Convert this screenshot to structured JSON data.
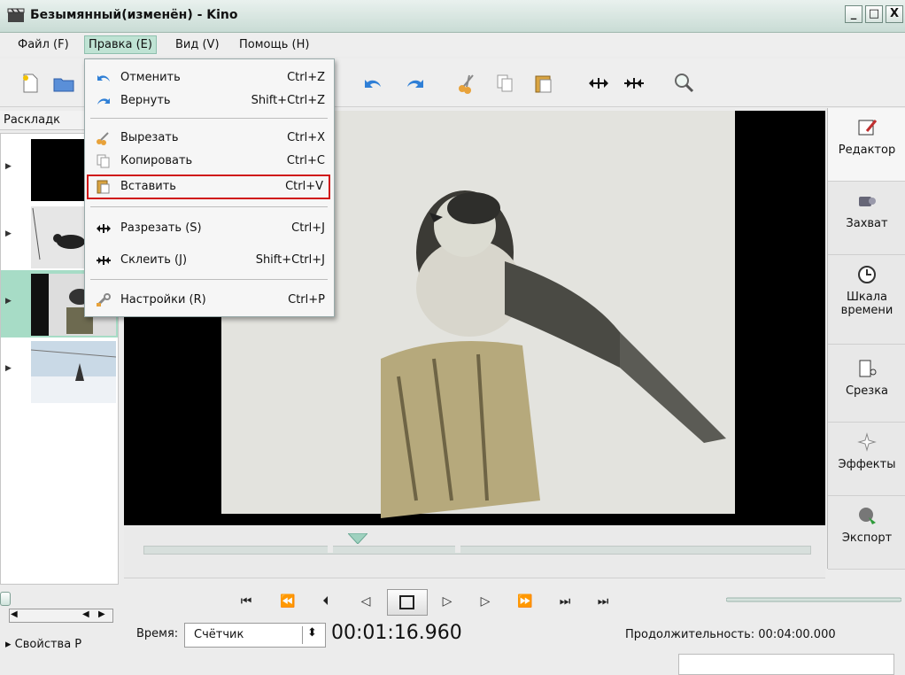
{
  "window": {
    "title": "Безымянный(изменён) - Kino",
    "minimize": "_",
    "maximize": "□",
    "close": "X"
  },
  "menubar": {
    "file": "Файл (F)",
    "edit": "Правка (E)",
    "view": "Вид (V)",
    "help": "Помощь (H)"
  },
  "edit_menu": {
    "items": [
      {
        "label": "Отменить",
        "shortcut": "Ctrl+Z",
        "icon": "undo-icon"
      },
      {
        "label": "Вернуть",
        "shortcut": "Shift+Ctrl+Z",
        "icon": "redo-icon"
      },
      {
        "label": "Вырезать",
        "shortcut": "Ctrl+X",
        "icon": "cut-icon"
      },
      {
        "label": "Копировать",
        "shortcut": "Ctrl+C",
        "icon": "copy-icon"
      },
      {
        "label": "Вставить",
        "shortcut": "Ctrl+V",
        "icon": "paste-icon",
        "highlighted": true
      },
      {
        "label": "Разрезать (S)",
        "shortcut": "Ctrl+J",
        "icon": "split-icon"
      },
      {
        "label": "Склеить (J)",
        "shortcut": "Shift+Ctrl+J",
        "icon": "join-icon"
      },
      {
        "label": "Настройки (R)",
        "shortcut": "Ctrl+P",
        "icon": "preferences-icon"
      }
    ]
  },
  "storyboard": {
    "header": "Раскладк"
  },
  "right_tabs": [
    {
      "label": "Редактор",
      "icon": "editor-icon"
    },
    {
      "label": "Захват",
      "icon": "capture-icon"
    },
    {
      "label": "Шкала времени",
      "icon": "timeline-icon"
    },
    {
      "label": "Срезка",
      "icon": "trim-icon"
    },
    {
      "label": "Эффекты",
      "icon": "effects-icon"
    },
    {
      "label": "Экспорт",
      "icon": "export-icon"
    }
  ],
  "bottom": {
    "time_label": "Время:",
    "time_mode": "Счётчик",
    "timecode": "00:01:16.960",
    "duration": "Продолжительность: 00:04:00.000",
    "properties": "Свойства Р"
  },
  "playback": {
    "volume_level": 0.5,
    "scrub_position": 0.33
  },
  "colors": {
    "accent": "#a7dcc6",
    "highlight_border": "#d01818"
  }
}
